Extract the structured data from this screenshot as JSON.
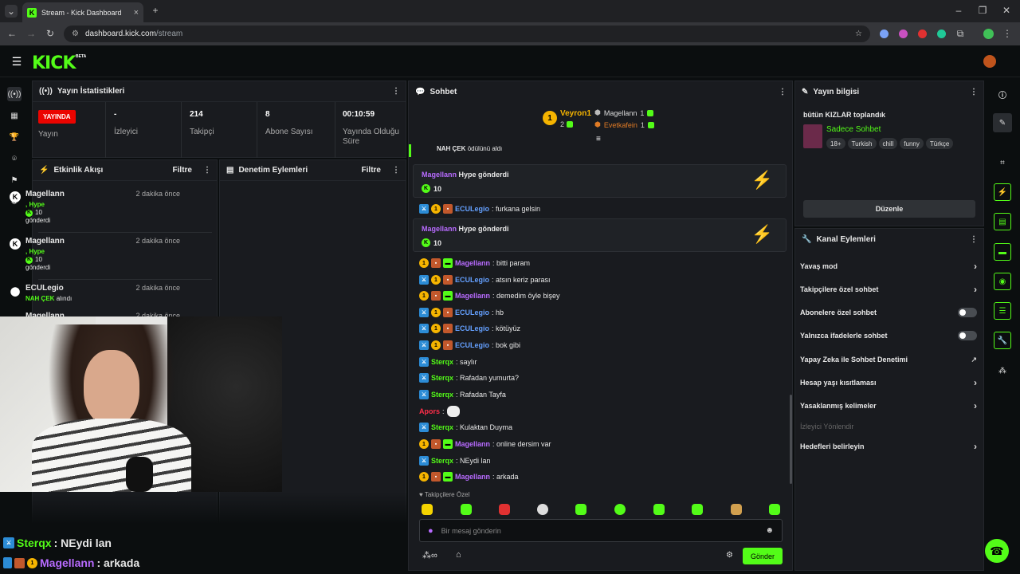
{
  "browser": {
    "tab_title": "Stream - Kick Dashboard",
    "url_host": "dashboard.kick.com",
    "url_path": "/stream"
  },
  "brand": {
    "logo": "KICK",
    "beta": "BETA",
    "accent": "#53fc18"
  },
  "stats": {
    "title": "Yayın İstatistikleri",
    "live_badge": "YAYINDA",
    "live_label": "Yayın",
    "viewers_value": "-",
    "viewers_label": "İzleyici",
    "followers_value": "214",
    "followers_label": "Takipçi",
    "subs_value": "8",
    "subs_label": "Abone Sayısı",
    "uptime_value": "00:10:59",
    "uptime_label": "Yayında Olduğu Süre"
  },
  "activity": {
    "title": "Etkinlik Akışı",
    "filter": "Filtre",
    "events": [
      {
        "user": "Magellann",
        "time": "2 dakika önce",
        "line1": ", Hype",
        "amount": "10",
        "line3": "gönderdi"
      },
      {
        "user": "Magellann",
        "time": "2 dakika önce",
        "line1": ", Hype",
        "amount": "10",
        "line3": "gönderdi"
      },
      {
        "user": "ECULegio",
        "time": "2 dakika önce",
        "reward": "NAH ÇEK",
        "reward_suffix": "alındı"
      },
      {
        "user": "Magellann",
        "time": "2 dakika önce"
      }
    ]
  },
  "moderation": {
    "title": "Denetim Eylemleri",
    "filter": "Filtre"
  },
  "chat": {
    "title": "Sohbet",
    "leaderboard": {
      "first_name": "Veyron1",
      "first_count": "2",
      "second_name": "Magellann",
      "second_count": "1",
      "third_name": "Evetkafein",
      "third_count": "1",
      "rank1": "1"
    },
    "reward_msg": {
      "user": "NAH ÇEK",
      "text": "ödülünü aldı"
    },
    "hype1": {
      "user": "Magellann",
      "text": "Hype gönderdi",
      "amount": "10"
    },
    "hype2": {
      "user": "Magellann",
      "text": "Hype gönderdi",
      "amount": "10"
    },
    "messages": [
      {
        "user": "ECULegio",
        "text": ": furkana gelsin"
      },
      {
        "user": "Magellann",
        "text": ": bitti param"
      },
      {
        "user": "ECULegio",
        "text": ": atsın keriz parası"
      },
      {
        "user": "Magellann",
        "text": ": demedim öyle bişey"
      },
      {
        "user": "ECULegio",
        "text": ": hb"
      },
      {
        "user": "ECULegio",
        "text": ": kötüyüz"
      },
      {
        "user": "ECULegio",
        "text": ": bok gibi"
      },
      {
        "user": "Sterqx",
        "text": ": saylır"
      },
      {
        "user": "Sterqx",
        "text": ": Rafadan yumurta?"
      },
      {
        "user": "Sterqx",
        "text": ": Rafadan Tayfa"
      },
      {
        "user": "Apors",
        "text": ":"
      },
      {
        "user": "Sterqx",
        "text": ": Kulaktan Duyma"
      },
      {
        "user": "Magellann",
        "text": ": online dersim var"
      },
      {
        "user": "Sterqx",
        "text": ": NEydi lan"
      },
      {
        "user": "Magellann",
        "text": ": arkada"
      }
    ],
    "followers_only": "Takipçilere Özel",
    "input_placeholder": "Bir mesaj gönderin",
    "send": "Gönder"
  },
  "stream_info": {
    "title": "Yayın bilgisi",
    "stream_title": "bütün KIZLAR toplandık",
    "category": "Sadece Sohbet",
    "tags": [
      "18+",
      "Turkish",
      "chill",
      "funny",
      "Türkçe"
    ],
    "edit": "Düzenle"
  },
  "channel_actions": {
    "title": "Kanal Eylemleri",
    "items": [
      {
        "label": "Yavaş mod",
        "control": "chevron"
      },
      {
        "label": "Takipçilere özel sohbet",
        "control": "chevron"
      },
      {
        "label": "Abonelere özel sohbet",
        "control": "toggle"
      },
      {
        "label": "Yalnızca ifadelerle sohbet",
        "control": "toggle"
      },
      {
        "label": "Yapay Zeka ile Sohbet Denetimi",
        "control": "external"
      },
      {
        "label": "Hesap yaşı kısıtlaması",
        "control": "chevron"
      },
      {
        "label": "Yasaklanmış kelimeler",
        "control": "chevron"
      },
      {
        "label": "İzleyici Yönlendir",
        "control": "none"
      },
      {
        "label": "Hedefleri belirleyin",
        "control": "chevron"
      }
    ]
  },
  "overlay": {
    "line1_user": "Sterqx",
    "line1_text": ": NEydi lan",
    "line2_user": "Magellann",
    "line2_text": ": arkada"
  }
}
